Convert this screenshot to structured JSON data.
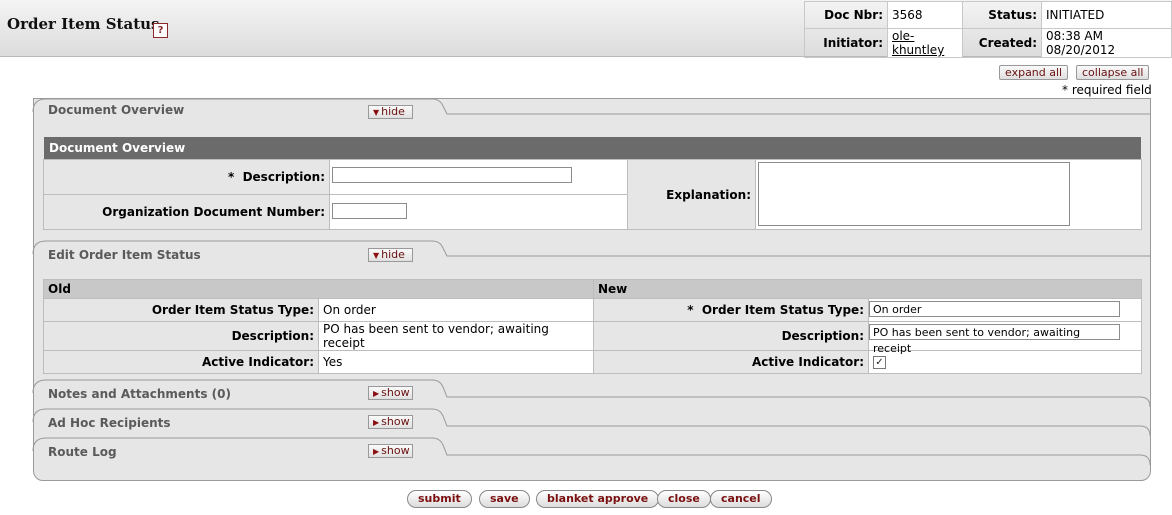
{
  "header": {
    "title": "Order Item Status",
    "help_icon": "?",
    "doc_nbr_label": "Doc Nbr:",
    "doc_nbr": "3568",
    "status_label": "Status:",
    "status": "INITIATED",
    "initiator_label": "Initiator:",
    "initiator": "ole-khuntley",
    "created_label": "Created:",
    "created": "08:38 AM 08/20/2012"
  },
  "controls": {
    "expand_all": "expand all",
    "collapse_all": "collapse all",
    "required_note": "* required field"
  },
  "tabs": {
    "document_overview": {
      "label": "Document Overview",
      "toggle": "hide"
    },
    "edit_status": {
      "label": "Edit Order Item Status",
      "toggle": "hide"
    },
    "notes": {
      "label": "Notes and Attachments (0)",
      "toggle": "show"
    },
    "adhoc": {
      "label": "Ad Hoc Recipients",
      "toggle": "show"
    },
    "route_log": {
      "label": "Route Log",
      "toggle": "show"
    }
  },
  "doc_overview": {
    "section_title": "Document Overview",
    "description_label": "Description:",
    "required_mark": "*",
    "description_value": "",
    "org_doc_label": "Organization Document Number:",
    "org_doc_value": "",
    "explanation_label": "Explanation:",
    "explanation_value": ""
  },
  "edit_status": {
    "old_header": "Old",
    "new_header": "New",
    "rows": [
      {
        "label": "Order Item Status Type:",
        "old": "On order",
        "new": "On order",
        "required": "*"
      },
      {
        "label": "Description:",
        "old": "PO has been sent to vendor; awaiting receipt",
        "new": "PO has been sent to vendor; awaiting receipt",
        "required": ""
      },
      {
        "label": "Active Indicator:",
        "old": "Yes",
        "new": "✓",
        "required": ""
      }
    ]
  },
  "footer": {
    "submit": "submit",
    "save": "save",
    "blanket_approve": "blanket approve",
    "close": "close",
    "cancel": "cancel"
  },
  "colors": {
    "section_bar": "#6b6b6b",
    "button_text": "#7a1010",
    "panel_bg": "#e6e6e6"
  }
}
